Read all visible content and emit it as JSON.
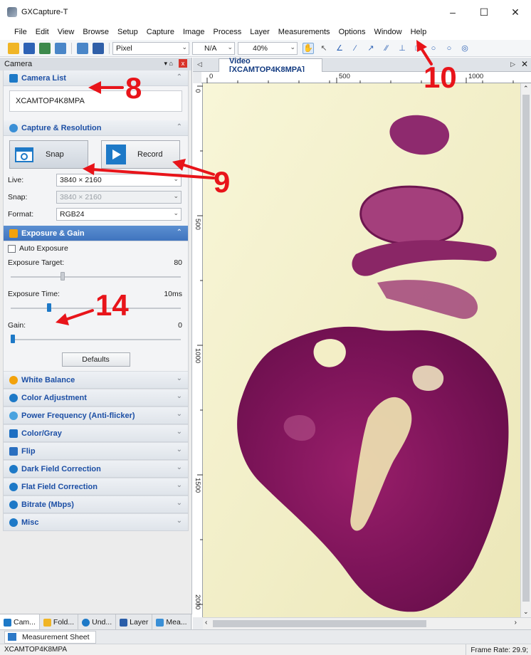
{
  "window": {
    "title": "GXCapture-T",
    "min_glyph": "–",
    "max_glyph": "☐",
    "close_glyph": "✕"
  },
  "menu": [
    "File",
    "Edit",
    "View",
    "Browse",
    "Setup",
    "Capture",
    "Image",
    "Process",
    "Layer",
    "Measurements",
    "Options",
    "Window",
    "Help"
  ],
  "toolbar": {
    "unit_value": "Pixel",
    "calib_value": "N/A",
    "zoom_value": "40%"
  },
  "dock": {
    "title": "Camera",
    "pin_glyph": "▾  ⌂",
    "close_glyph": "x",
    "camera_list": {
      "title": "Camera List",
      "camera_name": "XCAMTOP4K8MPA"
    },
    "capture": {
      "title": "Capture & Resolution",
      "snap_label": "Snap",
      "record_label": "Record",
      "live_label": "Live:",
      "live_value": "3840 × 2160",
      "snap_res_label": "Snap:",
      "snap_res_value": "3840 × 2160",
      "format_label": "Format:",
      "format_value": "RGB24"
    },
    "exposure": {
      "title": "Exposure & Gain",
      "auto_label": "Auto Exposure",
      "target_label": "Exposure Target:",
      "target_value": "80",
      "target_fraction": 0.3,
      "time_label": "Exposure Time:",
      "time_value": "10ms",
      "time_fraction": 0.22,
      "gain_label": "Gain:",
      "gain_value": "0",
      "gain_fraction": 0.0,
      "defaults_label": "Defaults"
    },
    "collapsed_sections": [
      {
        "label": "White Balance",
        "color": "#f2a20c"
      },
      {
        "label": "Color Adjustment",
        "color": "#1d79c7"
      },
      {
        "label": "Power Frequency (Anti-flicker)",
        "color": "#4aa3df"
      },
      {
        "label": "Color/Gray",
        "color": "#1d6fc2"
      },
      {
        "label": "Flip",
        "color": "#2a6fc0"
      },
      {
        "label": "Dark Field Correction",
        "color": "#1d79c7"
      },
      {
        "label": "Flat Field Correction",
        "color": "#1d79c7"
      },
      {
        "label": "Bitrate (Mbps)",
        "color": "#1d79c7"
      },
      {
        "label": "Misc",
        "color": "#1d79c7"
      }
    ],
    "tabs": [
      "Cam...",
      "Fold...",
      "Und...",
      "Layer",
      "Mea..."
    ]
  },
  "document": {
    "tab_title": "Video [XCAMTOP4K8MPA]",
    "left_arrow": "◁",
    "right_arrow": "▷",
    "close_glyph": "✕",
    "hruler_labels": [
      "0",
      "500",
      "1000"
    ],
    "vruler_labels": [
      "0",
      "500",
      "1000",
      "1500",
      "2000"
    ]
  },
  "bottom": {
    "measurement_tab": "Measurement Sheet",
    "status_left": "XCAMTOP4K8MPA",
    "status_right": "Frame Rate: 29.9;"
  },
  "annotations": {
    "callout_8": "8",
    "callout_9": "9",
    "callout_10": "10",
    "callout_14": "14",
    "color": "#e8141a"
  }
}
